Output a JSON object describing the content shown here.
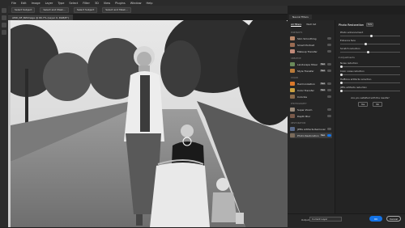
{
  "menubar": {
    "items": [
      "File",
      "Edit",
      "Image",
      "Layer",
      "Type",
      "Select",
      "Filter",
      "3D",
      "View",
      "Plugins",
      "Window",
      "Help"
    ]
  },
  "optionsbar": {
    "buttons": [
      "Select Subject",
      "Select and Mask...",
      "Select Subject",
      "Select and Mask..."
    ]
  },
  "document": {
    "tab_label": "AMD_NF_BWimage @ 66.7% (Layer 0, RGB/8*)"
  },
  "neural_filters": {
    "panel_title": "Neural Filters",
    "tabs": [
      "All filters",
      "Wait list"
    ],
    "categories": [
      {
        "name": "PORTRAITS",
        "items": [
          {
            "label": "Skin Smoothing",
            "thumb_color": "#b8876a",
            "toggle": false
          },
          {
            "label": "Smart Portrait",
            "thumb_color": "#9a6b52",
            "toggle": false
          },
          {
            "label": "Makeup Transfer",
            "thumb_color": "#c08a7a",
            "toggle": false
          }
        ]
      },
      {
        "name": "CREATIVE",
        "items": [
          {
            "label": "Landscape Mixer",
            "thumb_color": "#6a8a5a",
            "new": "New",
            "toggle": false
          },
          {
            "label": "Style Transfer",
            "thumb_color": "#b87a3a",
            "new": "New",
            "toggle": false
          }
        ]
      },
      {
        "name": "COLOR",
        "items": [
          {
            "label": "Harmonization",
            "thumb_color": "#d9782a",
            "new": "New",
            "toggle": false
          },
          {
            "label": "Color Transfer",
            "thumb_color": "#c9a040",
            "new": "New",
            "toggle": false
          },
          {
            "label": "Colorize",
            "thumb_color": "#8a6a4a",
            "toggle": false
          }
        ]
      },
      {
        "name": "PHOTOGRAPHY",
        "items": [
          {
            "label": "Super Zoom",
            "thumb_color": "#9a8a7a",
            "toggle": false
          },
          {
            "label": "Depth Blur",
            "thumb_color": "#7a5a4a",
            "toggle": false
          }
        ]
      },
      {
        "name": "RESTORATION",
        "items": [
          {
            "label": "JPEG Artifacts Removal",
            "thumb_color": "#5a6a8a",
            "toggle": false
          },
          {
            "label": "Photo Restoration",
            "thumb_color": "#7a6a5a",
            "new": "New",
            "toggle": true,
            "selected": true
          }
        ]
      }
    ]
  },
  "settings": {
    "title": "Photo Restoration",
    "badge": "Beta",
    "sliders": [
      {
        "label": "Photo enhancement",
        "value": 0.5
      },
      {
        "label": "Enhance face",
        "value": 0.4
      },
      {
        "label": "Scratch reduction",
        "value": 0.45
      }
    ],
    "adjustments_label": "Adjustments",
    "adjustment_sliders": [
      {
        "label": "Noise reduction",
        "value": 0.0
      },
      {
        "label": "Color noise reduction",
        "value": 0.0
      },
      {
        "label": "Halftone artifacts reduction",
        "value": 0.0
      },
      {
        "label": "JPEG artifacts reduction",
        "value": 0.0
      }
    ],
    "question": "Are you satisfied with the results?",
    "yes_label": "Yes",
    "no_label": "No"
  },
  "footer": {
    "output_label": "Output",
    "output_value": "Current Layer",
    "ok_label": "OK",
    "cancel_label": "Cancel"
  },
  "colors": {
    "accent": "#1473e6",
    "panel_bg": "#232323",
    "chrome_bg": "#2b2b2b"
  }
}
